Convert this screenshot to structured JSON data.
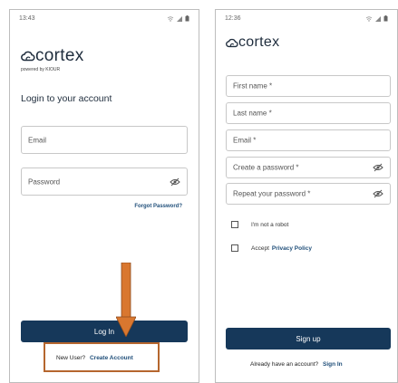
{
  "login": {
    "time": "13:43",
    "brand": "cortex",
    "powered_by": "powered by KIOUR",
    "heading": "Login to your account",
    "email_label": "Email",
    "password_label": "Password",
    "forgot_password": "Forgot Password?",
    "login_button": "Log In",
    "new_user_text": "New User?",
    "create_account": "Create Account"
  },
  "signup": {
    "time": "12:36",
    "brand": "cortex",
    "first_name": "First name *",
    "last_name": "Last name *",
    "email": "Email *",
    "create_password": "Create a password *",
    "repeat_password": "Repeat your password *",
    "not_robot": "I'm not a robot",
    "accept_text": "Accept",
    "privacy_policy": "Privacy Policy",
    "signup_button": "Sign up",
    "already_text": "Already have an account?",
    "sign_in": "Sign In"
  },
  "colors": {
    "accent": "#16385a",
    "annotation": "#b5662e",
    "arrow": "#d9772f"
  }
}
